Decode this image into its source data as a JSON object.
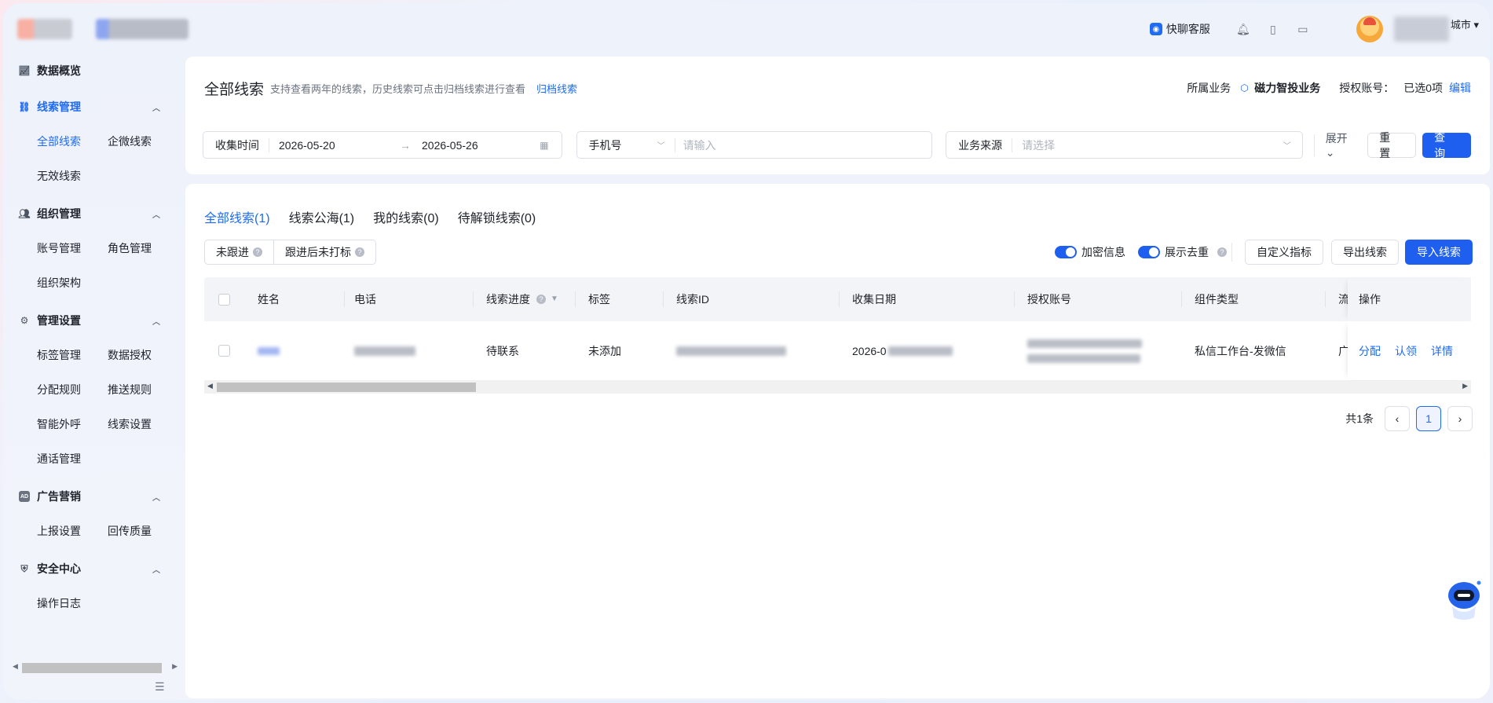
{
  "topbar": {
    "service_label": "快聊客服",
    "city_label": "城市",
    "icons": [
      "bell-icon",
      "phone-icon",
      "message-icon"
    ]
  },
  "sidebar": {
    "overview": "数据概览",
    "groups": [
      {
        "label": "线索管理",
        "icon": "lead-icon",
        "items": [
          "全部线索",
          "企微线索",
          "无效线索"
        ]
      },
      {
        "label": "组织管理",
        "icon": "people-icon",
        "items": [
          "账号管理",
          "角色管理",
          "组织架构"
        ]
      },
      {
        "label": "管理设置",
        "icon": "settings-icon",
        "items": [
          "标签管理",
          "数据授权",
          "分配规则",
          "推送规则",
          "智能外呼",
          "线索设置",
          "通话管理"
        ]
      },
      {
        "label": "广告营销",
        "icon": "ad-icon",
        "items": [
          "上报设置",
          "回传质量"
        ]
      },
      {
        "label": "安全中心",
        "icon": "shield-icon",
        "items": [
          "操作日志"
        ]
      }
    ],
    "active_item": "全部线索"
  },
  "header": {
    "title": "全部线索",
    "subtitle": "支持查看两年的线索，历史线索可点击归档线索进行查看",
    "archive_link": "归档线索",
    "business_label": "所属业务",
    "business_name": "磁力智投业务",
    "auth_label": "授权账号：",
    "auth_value": "已选0项",
    "edit_link": "编辑"
  },
  "filters": {
    "date_label": "收集时间",
    "date_start": "2026-05-20",
    "date_end": "2026-05-26",
    "phone_select": "手机号",
    "phone_placeholder": "请输入",
    "source_label": "业务来源",
    "source_placeholder": "请选择",
    "expand": "展开",
    "reset": "重 置",
    "search": "查 询"
  },
  "tabs": [
    {
      "label": "全部线索(1)",
      "active": true
    },
    {
      "label": "线索公海(1)",
      "active": false
    },
    {
      "label": "我的线索(0)",
      "active": false
    },
    {
      "label": "待解锁线索(0)",
      "active": false
    }
  ],
  "quick_filters": [
    "未跟进",
    "跟进后未打标"
  ],
  "list_tools": {
    "toggle1": "加密信息",
    "toggle2": "展示去重",
    "custom_metrics": "自定义指标",
    "export": "导出线索",
    "import": "导入线索"
  },
  "table": {
    "headers": [
      "姓名",
      "电话",
      "线索进度",
      "标签",
      "线索ID",
      "收集日期",
      "授权账号",
      "组件类型",
      "流",
      "操作"
    ],
    "rows": [
      {
        "progress": "待联系",
        "tag": "未添加",
        "date_prefix": "2026-0",
        "component_type": "私信工作台-发微信",
        "flow": "广",
        "actions": [
          "分配",
          "认领",
          "详情"
        ]
      }
    ]
  },
  "pagination": {
    "total": "共1条",
    "current": "1"
  }
}
